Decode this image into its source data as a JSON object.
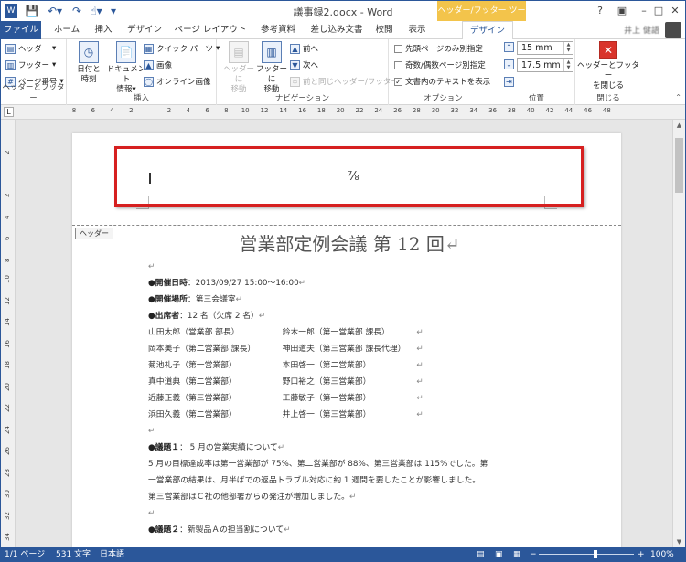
{
  "window": {
    "title": "議事録2.docx - Word",
    "contextual_tab_title": "ヘッダー/フッター ツール",
    "help": "?",
    "user_name": "井上 健語"
  },
  "tabs": [
    "ファイル",
    "ホーム",
    "挿入",
    "デザイン",
    "ページ レイアウト",
    "参考資料",
    "差し込み文書",
    "校閲",
    "表示",
    "デザイン"
  ],
  "ribbon": {
    "group_header_footer": {
      "label": "ヘッダーとフッター",
      "header": "ヘッダー",
      "footer": "フッター",
      "page_number": "ページ番号"
    },
    "group_insert": {
      "label": "挿入",
      "date_time": [
        "日付と",
        "時刻"
      ],
      "doc_info": [
        "ドキュメント",
        "情報"
      ],
      "quick_parts": "クイック パーツ",
      "picture": "画像",
      "online_picture": "オンライン画像"
    },
    "group_navigation": {
      "label": "ナビゲーション",
      "goto_header": [
        "ヘッダーに",
        "移動"
      ],
      "goto_footer": [
        "フッターに",
        "移動"
      ],
      "previous": "前へ",
      "next": "次へ",
      "link_previous": "前と同じヘッダー/フッター"
    },
    "group_options": {
      "label": "オプション",
      "first_page": "先頭ページのみ別指定",
      "odd_even": "奇数/偶数ページ別指定",
      "show_doc_text": "文書内のテキストを表示"
    },
    "group_position": {
      "label": "位置",
      "header_pos": "15 mm",
      "footer_pos": "17.5 mm"
    },
    "group_close": {
      "label": "閉じる",
      "close": [
        "ヘッダーとフッター",
        "を閉じる"
      ]
    }
  },
  "ruler": {
    "corner": "L",
    "ticks": [
      "8",
      "6",
      "4",
      "2",
      "",
      "2",
      "4",
      "6",
      "8",
      "10",
      "12",
      "14",
      "16",
      "18",
      "20",
      "22",
      "24",
      "26",
      "28",
      "30",
      "32",
      "34",
      "36",
      "38",
      "40",
      "42",
      "44",
      "46",
      "48"
    ],
    "vticks": [
      "2",
      "",
      "2",
      "4",
      "6",
      "8",
      "10",
      "12",
      "14",
      "16",
      "18",
      "20",
      "22",
      "24",
      "26",
      "28",
      "30",
      "32",
      "34"
    ]
  },
  "header_tag": "ヘッダー",
  "document": {
    "title": "営業部定例会議 第 12 回",
    "meeting_date_label": "●開催日時",
    "meeting_date": "：2013/09/27 15:00～16:00",
    "meeting_place_label": "●開催場所",
    "meeting_place": "：第三会議室",
    "attendees_label": "●出席者",
    "attendees_count": "：12 名（欠席 2 名）",
    "attendees": [
      [
        "山田太郎（営業部 部長）",
        "鈴木一郎（第一営業部 課長）"
      ],
      [
        "岡本美子（第二営業部 課長）",
        "神田道夫（第三営業部 課長代理）"
      ],
      [
        "菊池礼子（第一営業部）",
        "本田啓一（第二営業部）"
      ],
      [
        "真中道典（第二営業部）",
        "野口裕之（第三営業部）"
      ],
      [
        "近藤正義（第三営業部）",
        "工藤敏子（第一営業部）"
      ],
      [
        "浜田久義（第二営業部）",
        "井上啓一（第三営業部）"
      ]
    ],
    "agenda1_label": "●議題１",
    "agenda1": "： 5 月の営業実績について",
    "agenda1_body": [
      "5 月の目標達成率は第一営業部が 75%、第二営業部が 88%、第三営業部は 115%でした。第",
      "一営業部の結果は、月半ばでの返品トラブル対応に約 1 週間を要したことが影響しました。",
      "第三営業部はＣ社の他部署からの発注が増加しました。"
    ],
    "agenda2_label": "●議題２",
    "agenda2": "：新製品Ａの担当割について"
  },
  "status": {
    "page": "1/1 ページ",
    "words": "531 文字",
    "language": "日本語",
    "zoom": "100%",
    "zoom_minus": "−",
    "zoom_plus": "+"
  }
}
